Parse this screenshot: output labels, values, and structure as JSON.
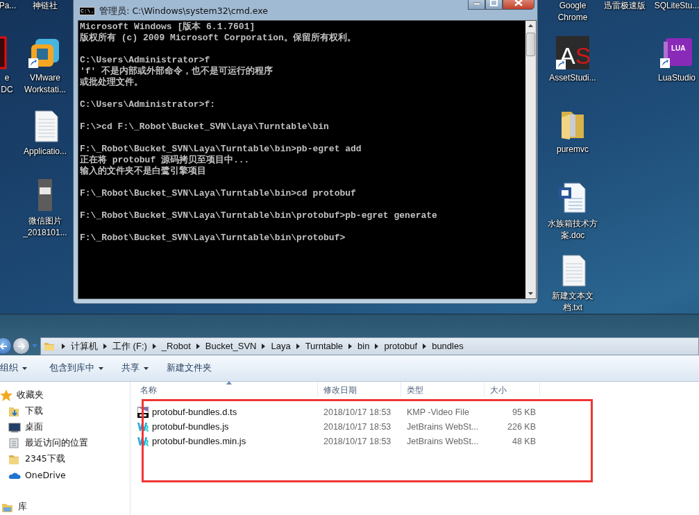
{
  "desktop": {
    "icons": [
      {
        "kind": "none",
        "label_lines": [
          "Pa..."
        ]
      },
      {
        "kind": "none",
        "label_lines": [
          "神链社"
        ]
      },
      {
        "kind": "none",
        "label_lines": [
          "Google",
          "Chrome"
        ]
      },
      {
        "kind": "none",
        "label_lines": [
          "迅雷极速版"
        ]
      },
      {
        "kind": "none",
        "label_lines": [
          "SQLiteStu..."
        ]
      },
      {
        "kind": "red-app",
        "shortcut": false,
        "label_lines": [
          "e",
          "DC"
        ]
      },
      {
        "kind": "vmware",
        "shortcut": true,
        "label_lines": [
          "VMware",
          "Workstati..."
        ]
      },
      {
        "kind": "asset",
        "shortcut": true,
        "label_lines": [
          "AssetStudi..."
        ]
      },
      {
        "kind": "book",
        "shortcut": true,
        "label_lines": [
          "LuaStudio"
        ]
      },
      {
        "kind": "text",
        "shortcut": false,
        "label_lines": [
          "Applicatio..."
        ]
      },
      {
        "kind": "folder",
        "shortcut": false,
        "label_lines": [
          "puremvc"
        ]
      },
      {
        "kind": "image",
        "shortcut": false,
        "label_lines": [
          "微信图片",
          "_2018101..."
        ]
      },
      {
        "kind": "word",
        "shortcut": false,
        "label_lines": [
          "水族箱技术方",
          "案.doc"
        ]
      },
      {
        "kind": "text",
        "shortcut": false,
        "label_lines": [
          "新建文本文",
          "档.txt"
        ]
      }
    ],
    "book_badge": "LUA",
    "asset_badge": "AS"
  },
  "console_window": {
    "title": "管理员: C:\\Windows\\system32\\cmd.exe",
    "icon_text": "C:\\.",
    "blocks": [
      [
        "Microsoft Windows [版本 6.1.7601]",
        "版权所有 (c) 2009 Microsoft Corporation。保留所有权利。"
      ],
      [
        "C:\\Users\\Administrator>f",
        "'f' 不是内部或外部命令，也不是可运行的程序",
        "或批处理文件。"
      ],
      [
        "C:\\Users\\Administrator>f:"
      ],
      [
        "F:\\>cd F:\\_Robot\\Bucket_SVN\\Laya\\Turntable\\bin"
      ],
      [
        "F:\\_Robot\\Bucket_SVN\\Laya\\Turntable\\bin>pb-egret add",
        "正在将 protobuf 源码拷贝至项目中...",
        "输入的文件夹不是白鹭引擎项目"
      ],
      [
        "F:\\_Robot\\Bucket_SVN\\Laya\\Turntable\\bin>cd protobuf"
      ],
      [
        "F:\\_Robot\\Bucket_SVN\\Laya\\Turntable\\bin\\protobuf>pb-egret generate"
      ],
      [
        "F:\\_Robot\\Bucket_SVN\\Laya\\Turntable\\bin\\protobuf>"
      ]
    ]
  },
  "explorer": {
    "breadcrumb": [
      "计算机",
      "工作 (F:)",
      "_Robot",
      "Bucket_SVN",
      "Laya",
      "Turntable",
      "bin",
      "protobuf",
      "bundles"
    ],
    "toolbar": [
      {
        "label": "组织",
        "menu": true
      },
      {
        "label": "包含到库中",
        "menu": true
      },
      {
        "label": "共享",
        "menu": true
      },
      {
        "label": "新建文件夹",
        "menu": false
      }
    ],
    "nav": [
      {
        "label": "收藏夹",
        "kind": "favorites"
      },
      {
        "label": "下载",
        "kind": "downloads"
      },
      {
        "label": "桌面",
        "kind": "desktop"
      },
      {
        "label": "最近访问的位置",
        "kind": "recent"
      },
      {
        "label": "2345下载",
        "kind": "folder"
      },
      {
        "label": "OneDrive",
        "kind": "cloud"
      },
      {
        "label": "库",
        "kind": "library"
      }
    ],
    "columns": [
      {
        "label": "名称",
        "sorted": true
      },
      {
        "label": "修改日期",
        "sorted": false
      },
      {
        "label": "类型",
        "sorted": false
      },
      {
        "label": "大小",
        "sorted": false
      }
    ],
    "files": [
      {
        "kind": "ts",
        "name": "protobuf-bundles.d.ts",
        "date": "2018/10/17 18:53",
        "type": "KMP -Video File",
        "size": "95 KB"
      },
      {
        "kind": "ws",
        "name": "protobuf-bundles.js",
        "date": "2018/10/17 18:53",
        "type": "JetBrains WebSt...",
        "size": "226 KB"
      },
      {
        "kind": "ws",
        "name": "protobuf-bundles.min.js",
        "date": "2018/10/17 18:53",
        "type": "JetBrains WebSt...",
        "size": "48 KB"
      }
    ]
  }
}
